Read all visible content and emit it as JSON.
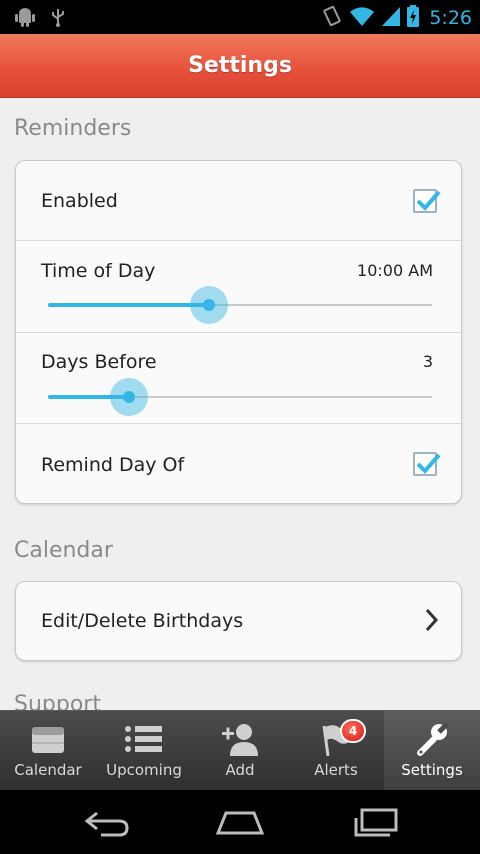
{
  "status_bar": {
    "time": "5:26",
    "icons": [
      "android-debug-icon",
      "usb-icon",
      "vibrate-icon",
      "wifi-icon",
      "signal-icon",
      "battery-icon"
    ]
  },
  "header": {
    "title": "Settings"
  },
  "reminders": {
    "section_title": "Reminders",
    "enabled_label": "Enabled",
    "enabled_checked": true,
    "time_of_day_label": "Time of Day",
    "time_of_day_value": "10:00 AM",
    "time_of_day_slider_fraction": 0.42,
    "days_before_label": "Days Before",
    "days_before_value": "3",
    "days_before_slider_fraction": 0.21,
    "remind_day_of_label": "Remind Day Of",
    "remind_day_of_checked": true
  },
  "calendar": {
    "section_title": "Calendar",
    "edit_label": "Edit/Delete Birthdays"
  },
  "support": {
    "section_title": "Support"
  },
  "tabs": [
    {
      "label": "Calendar",
      "icon": "calendar-icon"
    },
    {
      "label": "Upcoming",
      "icon": "list-icon"
    },
    {
      "label": "Add",
      "icon": "add-person-icon"
    },
    {
      "label": "Alerts",
      "icon": "flag-icon",
      "badge": "4"
    },
    {
      "label": "Settings",
      "icon": "wrench-icon",
      "active": true
    }
  ],
  "colors": {
    "accent": "#33b5e5",
    "header": "#e64f39",
    "badge": "#d11d12"
  }
}
